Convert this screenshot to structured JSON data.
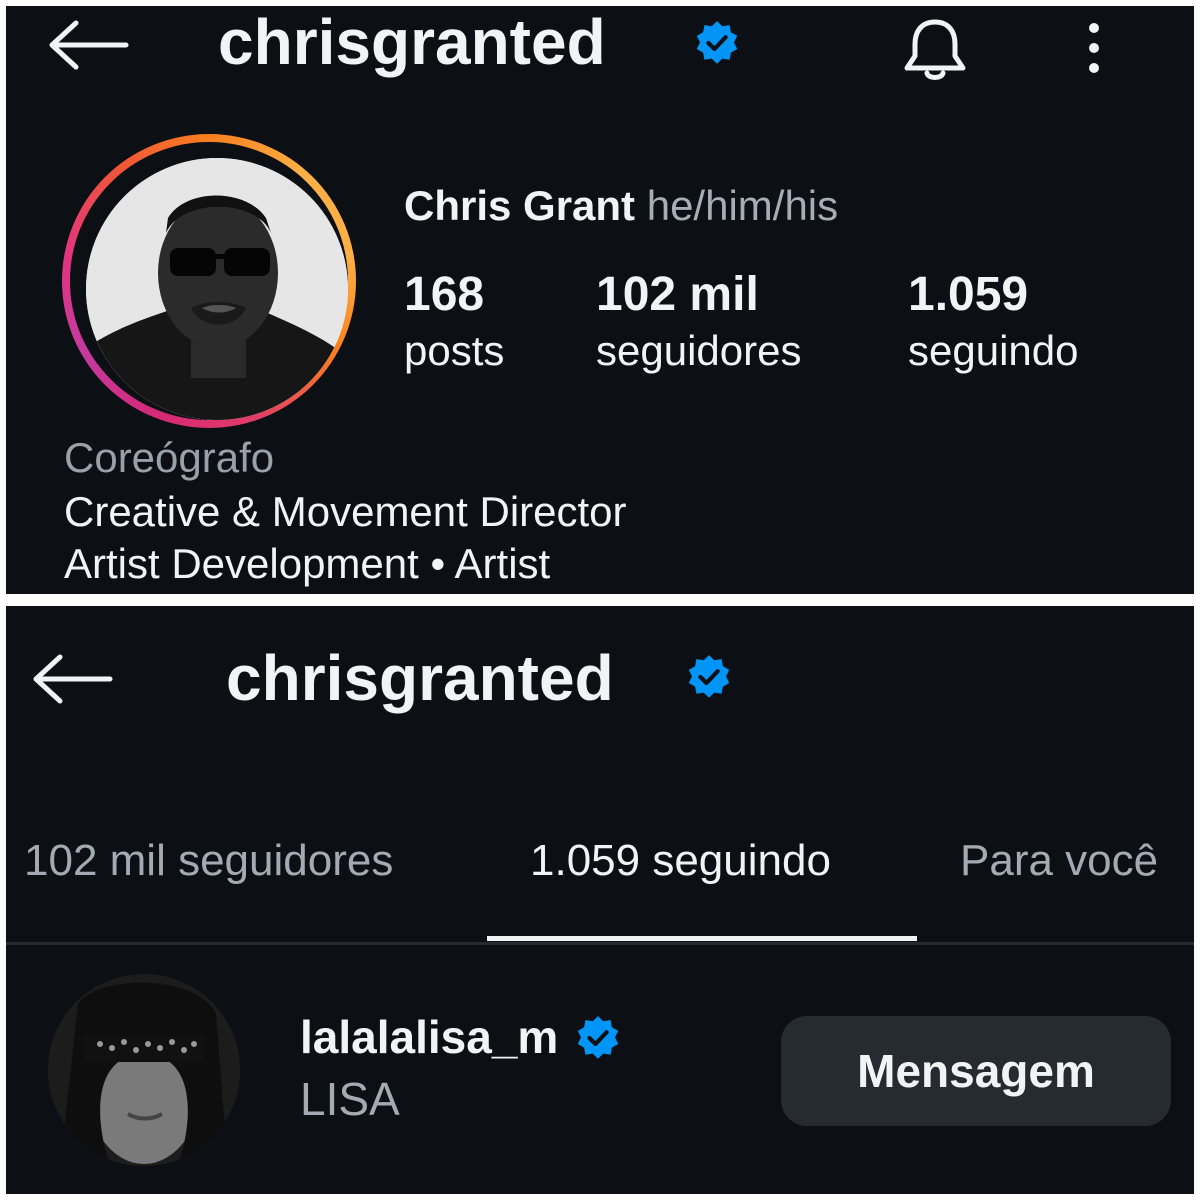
{
  "top_panel": {
    "header": {
      "username": "chrisgranted",
      "back_icon": "arrow-left-icon",
      "verified_icon": "verified-badge-icon",
      "notification_icon": "bell-icon",
      "more_icon": "more-vertical-icon"
    },
    "profile": {
      "name": "Chris Grant",
      "pronouns": "he/him/his",
      "stats": [
        {
          "value": "168",
          "label": "posts"
        },
        {
          "value": "102 mil",
          "label": "seguidores"
        },
        {
          "value": "1.059",
          "label": "seguindo"
        }
      ],
      "bio_category": "Coreógrafo",
      "bio_lines": [
        "Creative & Movement Director",
        "Artist Development • Artist"
      ]
    }
  },
  "bottom_panel": {
    "header": {
      "username": "chrisgranted",
      "back_icon": "arrow-left-icon",
      "verified_icon": "verified-badge-icon"
    },
    "tabs": [
      {
        "label": "102 mil seguidores",
        "active": false
      },
      {
        "label": "1.059 seguindo",
        "active": true
      },
      {
        "label": "Para você",
        "active": false
      }
    ],
    "following_list": [
      {
        "username": "lalalalisa_m",
        "full_name": "LISA",
        "verified": true,
        "button_label": "Mensagem"
      }
    ]
  },
  "colors": {
    "background": "#0c0f14",
    "text_primary": "#f2f3f5",
    "text_secondary": "#a4aab4",
    "verified_blue": "#0095f6",
    "button_bg": "#262a31"
  }
}
